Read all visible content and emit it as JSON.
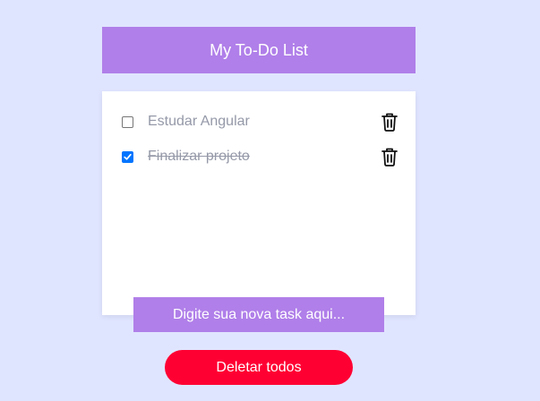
{
  "header": {
    "title": "My To-Do List"
  },
  "tasks": [
    {
      "label": "Estudar Angular",
      "done": false
    },
    {
      "label": "Finalizar projeto",
      "done": true
    }
  ],
  "input": {
    "placeholder": "Digite sua nova task aqui..."
  },
  "actions": {
    "delete_all_label": "Deletar todos"
  },
  "colors": {
    "background": "#e0e5ff",
    "accent": "#b07fe9",
    "danger": "#ff0033",
    "checkbox_checked": "#0075ff",
    "task_text": "#9599a8"
  },
  "icons": {
    "delete_task": "trash-icon",
    "checkmark": "checkmark-icon"
  }
}
